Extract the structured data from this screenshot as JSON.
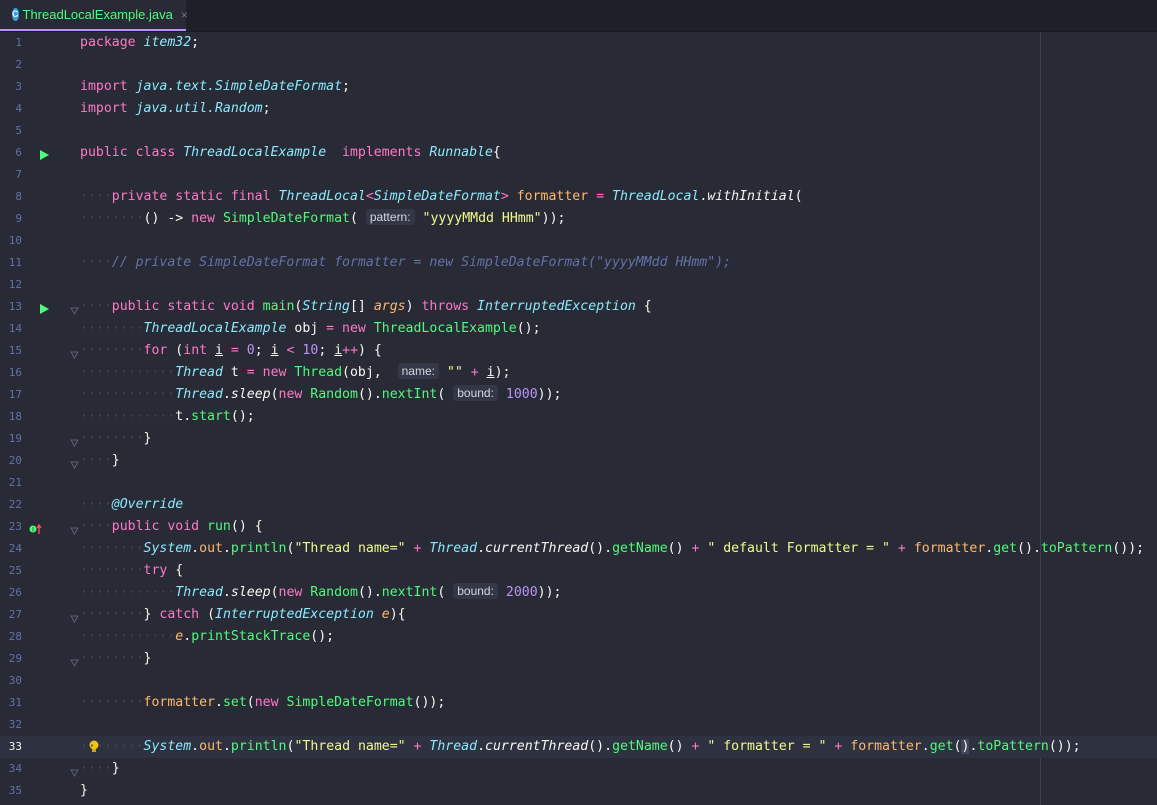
{
  "tab": {
    "title": "ThreadLocalExample.java",
    "close_glyph": "×",
    "icon_letter": "C"
  },
  "current_line": 33,
  "colors": {
    "background": "#282a36",
    "accent": "#bd93f9",
    "tab_text": "#50fa7b"
  },
  "lines": [
    {
      "n": "1",
      "indent": 0,
      "segs": [
        [
          "kw",
          "package "
        ],
        [
          "cls",
          "item32"
        ],
        [
          "plain",
          ";"
        ]
      ]
    },
    {
      "n": "2",
      "indent": 0,
      "segs": []
    },
    {
      "n": "3",
      "indent": 0,
      "segs": [
        [
          "kw",
          "import "
        ],
        [
          "cls",
          "java.text.SimpleDateFormat"
        ],
        [
          "plain",
          ";"
        ]
      ]
    },
    {
      "n": "4",
      "indent": 0,
      "segs": [
        [
          "kw",
          "import "
        ],
        [
          "cls",
          "java.util.Random"
        ],
        [
          "plain",
          ";"
        ]
      ]
    },
    {
      "n": "5",
      "indent": 0,
      "segs": []
    },
    {
      "n": "6",
      "indent": 0,
      "gutter": "run-icon",
      "segs": [
        [
          "kw",
          "public class "
        ],
        [
          "cls",
          "ThreadLocalExample"
        ],
        [
          "plain",
          "  "
        ],
        [
          "kw",
          "implements "
        ],
        [
          "cls",
          "Runnable"
        ],
        [
          "plain",
          "{"
        ]
      ]
    },
    {
      "n": "7",
      "indent": 0,
      "segs": []
    },
    {
      "n": "8",
      "indent": 1,
      "segs": [
        [
          "kw",
          "private static final "
        ],
        [
          "cls",
          "ThreadLocal"
        ],
        [
          "kw",
          "<"
        ],
        [
          "cls",
          "SimpleDateFormat"
        ],
        [
          "kw",
          "> "
        ],
        [
          "field",
          "formatter"
        ],
        [
          "kw",
          " = "
        ],
        [
          "cls",
          "ThreadLocal"
        ],
        [
          "plain",
          "."
        ],
        [
          "plain",
          "withInitial",
          "italic"
        ],
        [
          "plain",
          "("
        ]
      ]
    },
    {
      "n": "9",
      "indent": 2,
      "segs": [
        [
          "plain",
          "() -> "
        ],
        [
          "kw",
          "new "
        ],
        [
          "fn",
          "SimpleDateFormat"
        ],
        [
          "plain",
          "( "
        ],
        [
          "hint",
          "pattern:"
        ],
        [
          "str",
          " \"yyyyMMdd HHmm\""
        ],
        [
          "plain",
          "));"
        ]
      ]
    },
    {
      "n": "10",
      "indent": 0,
      "segs": []
    },
    {
      "n": "11",
      "indent": 1,
      "segs": [
        [
          "cm",
          "// private SimpleDateFormat formatter = new SimpleDateFormat(\"yyyyMMdd HHmm\");"
        ]
      ]
    },
    {
      "n": "12",
      "indent": 0,
      "segs": []
    },
    {
      "n": "13",
      "indent": 1,
      "gutter": "run-icon",
      "fold": true,
      "segs": [
        [
          "kw",
          "public static void "
        ],
        [
          "fn",
          "main"
        ],
        [
          "plain",
          "("
        ],
        [
          "cls",
          "String"
        ],
        [
          "plain",
          "[] "
        ],
        [
          "param",
          "args"
        ],
        [
          "plain",
          ") "
        ],
        [
          "kw",
          "throws "
        ],
        [
          "cls",
          "InterruptedException"
        ],
        [
          "plain",
          " {"
        ]
      ]
    },
    {
      "n": "14",
      "indent": 2,
      "segs": [
        [
          "cls",
          "ThreadLocalExample"
        ],
        [
          "plain",
          " obj "
        ],
        [
          "kw",
          "= new "
        ],
        [
          "fn",
          "ThreadLocalExample"
        ],
        [
          "plain",
          "();"
        ]
      ]
    },
    {
      "n": "15",
      "indent": 2,
      "fold": true,
      "segs": [
        [
          "kw",
          "for "
        ],
        [
          "plain",
          "("
        ],
        [
          "kw",
          "int "
        ],
        [
          "plain",
          "i",
          "ul"
        ],
        [
          "kw",
          " = "
        ],
        [
          "num",
          "0"
        ],
        [
          "plain",
          "; "
        ],
        [
          "plain",
          "i",
          "ul"
        ],
        [
          "kw",
          " < "
        ],
        [
          "num",
          "10"
        ],
        [
          "plain",
          "; "
        ],
        [
          "plain",
          "i",
          "ul"
        ],
        [
          "kw",
          "++"
        ],
        [
          "plain",
          ") {"
        ]
      ]
    },
    {
      "n": "16",
      "indent": 3,
      "segs": [
        [
          "cls",
          "Thread"
        ],
        [
          "plain",
          " t "
        ],
        [
          "kw",
          "= new "
        ],
        [
          "fn",
          "Thread"
        ],
        [
          "plain",
          "(obj,  "
        ],
        [
          "hint",
          "name:"
        ],
        [
          "str",
          " \"\""
        ],
        [
          "kw",
          " + "
        ],
        [
          "plain",
          "i",
          "ul"
        ],
        [
          "plain",
          ");"
        ]
      ]
    },
    {
      "n": "17",
      "indent": 3,
      "segs": [
        [
          "cls",
          "Thread"
        ],
        [
          "plain",
          "."
        ],
        [
          "plain",
          "sleep",
          "italic"
        ],
        [
          "plain",
          "("
        ],
        [
          "kw",
          "new "
        ],
        [
          "fn",
          "Random"
        ],
        [
          "plain",
          "()."
        ],
        [
          "fn",
          "nextInt"
        ],
        [
          "plain",
          "( "
        ],
        [
          "hint",
          "bound:"
        ],
        [
          "num",
          " 1000"
        ],
        [
          "plain",
          "));"
        ]
      ]
    },
    {
      "n": "18",
      "indent": 3,
      "segs": [
        [
          "plain",
          "t."
        ],
        [
          "fn",
          "start"
        ],
        [
          "plain",
          "();"
        ]
      ]
    },
    {
      "n": "19",
      "indent": 2,
      "fold": true,
      "segs": [
        [
          "plain",
          "}"
        ]
      ]
    },
    {
      "n": "20",
      "indent": 1,
      "fold": true,
      "segs": [
        [
          "plain",
          "}"
        ]
      ]
    },
    {
      "n": "21",
      "indent": 0,
      "segs": []
    },
    {
      "n": "22",
      "indent": 1,
      "segs": [
        [
          "ann",
          "@Override"
        ]
      ]
    },
    {
      "n": "23",
      "indent": 1,
      "gutter": "override-icon",
      "fold": true,
      "segs": [
        [
          "kw",
          "public void "
        ],
        [
          "fn",
          "run"
        ],
        [
          "plain",
          "() {"
        ]
      ]
    },
    {
      "n": "24",
      "indent": 2,
      "segs": [
        [
          "cls",
          "System"
        ],
        [
          "plain",
          "."
        ],
        [
          "field",
          "out"
        ],
        [
          "plain",
          "."
        ],
        [
          "fn",
          "println"
        ],
        [
          "plain",
          "("
        ],
        [
          "str",
          "\"Thread name=\""
        ],
        [
          "kw",
          " + "
        ],
        [
          "cls",
          "Thread"
        ],
        [
          "plain",
          "."
        ],
        [
          "plain",
          "currentThread",
          "italic"
        ],
        [
          "plain",
          "()."
        ],
        [
          "fn",
          "getName"
        ],
        [
          "plain",
          "()"
        ],
        [
          "kw",
          " + "
        ],
        [
          "str",
          "\" default Formatter = \""
        ],
        [
          "kw",
          " + "
        ],
        [
          "field",
          "formatter"
        ],
        [
          "plain",
          "."
        ],
        [
          "fn",
          "get"
        ],
        [
          "plain",
          "()."
        ],
        [
          "fn",
          "toPattern"
        ],
        [
          "plain",
          "());"
        ]
      ]
    },
    {
      "n": "25",
      "indent": 2,
      "segs": [
        [
          "kw",
          "try "
        ],
        [
          "plain",
          "{"
        ]
      ]
    },
    {
      "n": "26",
      "indent": 3,
      "segs": [
        [
          "cls",
          "Thread"
        ],
        [
          "plain",
          "."
        ],
        [
          "plain",
          "sleep",
          "italic"
        ],
        [
          "plain",
          "("
        ],
        [
          "kw",
          "new "
        ],
        [
          "fn",
          "Random"
        ],
        [
          "plain",
          "()."
        ],
        [
          "fn",
          "nextInt"
        ],
        [
          "plain",
          "( "
        ],
        [
          "hint",
          "bound:"
        ],
        [
          "num",
          " 2000"
        ],
        [
          "plain",
          "));"
        ]
      ]
    },
    {
      "n": "27",
      "indent": 2,
      "fold": true,
      "segs": [
        [
          "plain",
          "} "
        ],
        [
          "kw",
          "catch "
        ],
        [
          "plain",
          "("
        ],
        [
          "cls",
          "InterruptedException"
        ],
        [
          "plain",
          " "
        ],
        [
          "param",
          "e"
        ],
        [
          "plain",
          "){"
        ]
      ]
    },
    {
      "n": "28",
      "indent": 3,
      "segs": [
        [
          "param",
          "e"
        ],
        [
          "plain",
          "."
        ],
        [
          "fn",
          "printStackTrace"
        ],
        [
          "plain",
          "();"
        ]
      ]
    },
    {
      "n": "29",
      "indent": 2,
      "fold": true,
      "segs": [
        [
          "plain",
          "}"
        ]
      ]
    },
    {
      "n": "30",
      "indent": 0,
      "segs": []
    },
    {
      "n": "31",
      "indent": 2,
      "segs": [
        [
          "field",
          "formatter"
        ],
        [
          "plain",
          "."
        ],
        [
          "fn",
          "set"
        ],
        [
          "plain",
          "("
        ],
        [
          "kw",
          "new "
        ],
        [
          "fn",
          "SimpleDateFormat"
        ],
        [
          "plain",
          "());"
        ]
      ]
    },
    {
      "n": "32",
      "indent": 0,
      "segs": []
    },
    {
      "n": "33",
      "indent": 2,
      "gutter": "bulb-icon",
      "segs": [
        [
          "cls",
          "System"
        ],
        [
          "plain",
          "."
        ],
        [
          "field",
          "out"
        ],
        [
          "plain",
          "."
        ],
        [
          "fn",
          "println"
        ],
        [
          "plain",
          "("
        ],
        [
          "str",
          "\"Thread name=\""
        ],
        [
          "kw",
          " + "
        ],
        [
          "cls",
          "Thread"
        ],
        [
          "plain",
          "."
        ],
        [
          "plain",
          "currentThread",
          "italic"
        ],
        [
          "plain",
          "()."
        ],
        [
          "fn",
          "getName"
        ],
        [
          "plain",
          "()"
        ],
        [
          "kw",
          " + "
        ],
        [
          "str",
          "\" formatter = \""
        ],
        [
          "kw",
          " + "
        ],
        [
          "field",
          "formatter"
        ],
        [
          "plain",
          "."
        ],
        [
          "fn",
          "get"
        ],
        [
          "plain",
          "("
        ],
        [
          "plain",
          ")",
          "brace-hl"
        ],
        [
          "plain",
          "."
        ],
        [
          "fn",
          "toPattern"
        ],
        [
          "plain",
          "());"
        ]
      ]
    },
    {
      "n": "34",
      "indent": 1,
      "fold": true,
      "segs": [
        [
          "plain",
          "}"
        ]
      ]
    },
    {
      "n": "35",
      "indent": 0,
      "segs": [
        [
          "plain",
          "}"
        ]
      ]
    }
  ]
}
